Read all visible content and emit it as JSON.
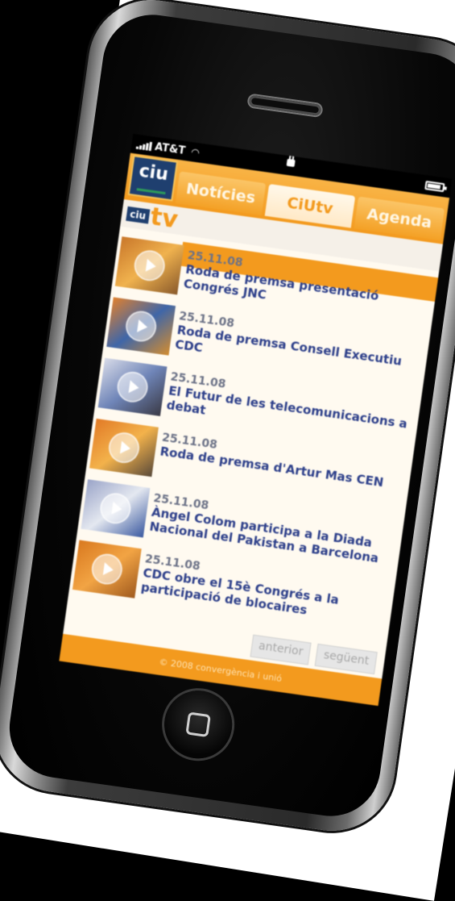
{
  "status": {
    "carrier": "AT&T"
  },
  "header": {
    "logo_text": "ciu",
    "tabs": [
      {
        "label": "Notícies"
      },
      {
        "label": "CiUtv"
      },
      {
        "label": "Agenda"
      }
    ]
  },
  "subheader": {
    "badge": "ciu",
    "tv": "tv"
  },
  "items": [
    {
      "date": "25.11.08",
      "title": "Roda de premsa presentació Congrés JNC"
    },
    {
      "date": "25.11.08",
      "title": "Roda de premsa Consell Executiu CDC"
    },
    {
      "date": "25.11.08",
      "title": "El Futur de les telecomunicacions a debat"
    },
    {
      "date": "25.11.08",
      "title": "Roda de premsa d'Artur Mas CEN"
    },
    {
      "date": "25.11.08",
      "title": "Àngel Colom participa a la Diada Nacional del Pakistan a Barcelona"
    },
    {
      "date": "25.11.08",
      "title": "CDC obre el 15è Congrés a la participació de blocaires"
    }
  ],
  "pager": {
    "prev": "anterior",
    "next": "següent"
  },
  "footer": {
    "text": "© 2008 convergència i unió"
  },
  "colors": {
    "accent": "#f39a1e",
    "link": "#2d3f8a",
    "brand_blue": "#1f3f6f"
  }
}
